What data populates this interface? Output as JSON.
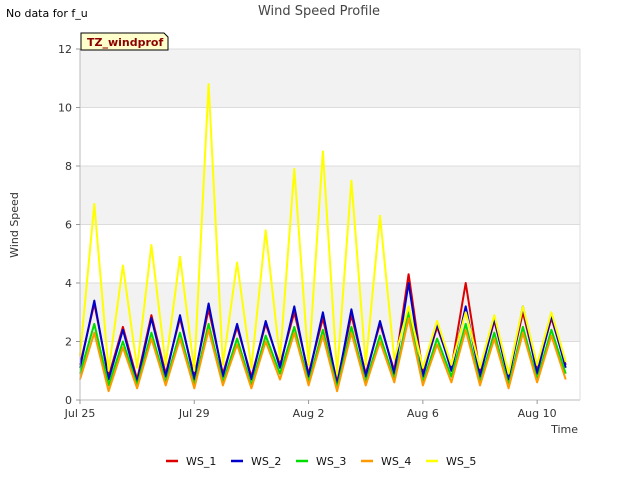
{
  "note": "No data for f_u",
  "chart_data": {
    "type": "line",
    "title": "Wind Speed Profile",
    "xlabel": "Time",
    "ylabel": "Wind Speed",
    "site_tag": "TZ_windprof",
    "ylim": [
      0,
      12
    ],
    "xlim": [
      "2023-07-25",
      "2023-08-11T12:00"
    ],
    "yticks": [
      0,
      2,
      4,
      6,
      8,
      10,
      12
    ],
    "xticks": [
      {
        "date": "2023-07-25",
        "label": "Jul 25"
      },
      {
        "date": "2023-07-29",
        "label": "Jul 29"
      },
      {
        "date": "2023-08-02",
        "label": "Aug 2"
      },
      {
        "date": "2023-08-06",
        "label": "Aug 6"
      },
      {
        "date": "2023-08-10",
        "label": "Aug 10"
      }
    ],
    "shaded_bands": [
      [
        2,
        4
      ],
      [
        6,
        8
      ],
      [
        10,
        12
      ]
    ],
    "legend_position": "bottom",
    "series": [
      {
        "name": "WS_1",
        "color": "#dd0000",
        "x": [
          "2023-07-25T00:00",
          "2023-07-25T12:00",
          "2023-07-26T00:00",
          "2023-07-26T12:00",
          "2023-07-27T00:00",
          "2023-07-27T12:00",
          "2023-07-28T00:00",
          "2023-07-28T12:00",
          "2023-07-29T00:00",
          "2023-07-29T12:00",
          "2023-07-30T00:00",
          "2023-07-30T12:00",
          "2023-07-31T00:00",
          "2023-07-31T12:00",
          "2023-08-01T00:00",
          "2023-08-01T12:00",
          "2023-08-02T00:00",
          "2023-08-02T12:00",
          "2023-08-03T00:00",
          "2023-08-03T12:00",
          "2023-08-04T00:00",
          "2023-08-04T12:00",
          "2023-08-05T00:00",
          "2023-08-05T12:00",
          "2023-08-06T00:00",
          "2023-08-06T12:00",
          "2023-08-07T00:00",
          "2023-08-07T12:00",
          "2023-08-08T00:00",
          "2023-08-08T12:00",
          "2023-08-09T00:00",
          "2023-08-09T12:00",
          "2023-08-10T00:00",
          "2023-08-10T12:00",
          "2023-08-11T00:00"
        ],
        "values": [
          1.2,
          3.3,
          0.8,
          2.5,
          0.7,
          2.9,
          0.9,
          2.8,
          0.8,
          3.1,
          0.9,
          2.5,
          0.8,
          2.6,
          1.2,
          3.0,
          0.9,
          2.8,
          0.6,
          2.9,
          0.9,
          2.6,
          1.0,
          4.3,
          0.9,
          2.5,
          1.1,
          4.0,
          0.9,
          2.7,
          0.8,
          3.0,
          1.0,
          2.8,
          1.2
        ]
      },
      {
        "name": "WS_2",
        "color": "#0000cc",
        "x": [
          "2023-07-25T00:00",
          "2023-07-25T12:00",
          "2023-07-26T00:00",
          "2023-07-26T12:00",
          "2023-07-27T00:00",
          "2023-07-27T12:00",
          "2023-07-28T00:00",
          "2023-07-28T12:00",
          "2023-07-29T00:00",
          "2023-07-29T12:00",
          "2023-07-30T00:00",
          "2023-07-30T12:00",
          "2023-07-31T00:00",
          "2023-07-31T12:00",
          "2023-08-01T00:00",
          "2023-08-01T12:00",
          "2023-08-02T00:00",
          "2023-08-02T12:00",
          "2023-08-03T00:00",
          "2023-08-03T12:00",
          "2023-08-04T00:00",
          "2023-08-04T12:00",
          "2023-08-05T00:00",
          "2023-08-05T12:00",
          "2023-08-06T00:00",
          "2023-08-06T12:00",
          "2023-08-07T00:00",
          "2023-08-07T12:00",
          "2023-08-08T00:00",
          "2023-08-08T12:00",
          "2023-08-09T00:00",
          "2023-08-09T12:00",
          "2023-08-10T00:00",
          "2023-08-10T12:00",
          "2023-08-11T00:00"
        ],
        "values": [
          1.1,
          3.4,
          0.7,
          2.4,
          0.6,
          2.8,
          0.8,
          2.9,
          0.7,
          3.3,
          0.8,
          2.6,
          0.7,
          2.7,
          1.1,
          3.2,
          0.8,
          3.0,
          0.5,
          3.1,
          0.8,
          2.7,
          0.9,
          4.0,
          0.8,
          2.6,
          1.0,
          3.2,
          0.8,
          2.8,
          0.7,
          3.2,
          0.9,
          2.9,
          1.1
        ]
      },
      {
        "name": "WS_3",
        "color": "#00dd00",
        "x": [
          "2023-07-25T00:00",
          "2023-07-25T12:00",
          "2023-07-26T00:00",
          "2023-07-26T12:00",
          "2023-07-27T00:00",
          "2023-07-27T12:00",
          "2023-07-28T00:00",
          "2023-07-28T12:00",
          "2023-07-29T00:00",
          "2023-07-29T12:00",
          "2023-07-30T00:00",
          "2023-07-30T12:00",
          "2023-07-31T00:00",
          "2023-07-31T12:00",
          "2023-08-01T00:00",
          "2023-08-01T12:00",
          "2023-08-02T00:00",
          "2023-08-02T12:00",
          "2023-08-03T00:00",
          "2023-08-03T12:00",
          "2023-08-04T00:00",
          "2023-08-04T12:00",
          "2023-08-05T00:00",
          "2023-08-05T12:00",
          "2023-08-06T00:00",
          "2023-08-06T12:00",
          "2023-08-07T00:00",
          "2023-08-07T12:00",
          "2023-08-08T00:00",
          "2023-08-08T12:00",
          "2023-08-09T00:00",
          "2023-08-09T12:00",
          "2023-08-10T00:00",
          "2023-08-10T12:00",
          "2023-08-11T00:00"
        ],
        "values": [
          0.9,
          2.6,
          0.5,
          2.0,
          0.5,
          2.3,
          0.6,
          2.3,
          0.5,
          2.6,
          0.6,
          2.1,
          0.5,
          2.2,
          0.9,
          2.5,
          0.6,
          2.4,
          0.4,
          2.5,
          0.6,
          2.2,
          0.7,
          3.0,
          0.6,
          2.1,
          0.8,
          2.6,
          0.6,
          2.3,
          0.5,
          2.5,
          0.7,
          2.4,
          0.9
        ]
      },
      {
        "name": "WS_4",
        "color": "#ff9900",
        "x": [
          "2023-07-25T00:00",
          "2023-07-25T12:00",
          "2023-07-26T00:00",
          "2023-07-26T12:00",
          "2023-07-27T00:00",
          "2023-07-27T12:00",
          "2023-07-28T00:00",
          "2023-07-28T12:00",
          "2023-07-29T00:00",
          "2023-07-29T12:00",
          "2023-07-30T00:00",
          "2023-07-30T12:00",
          "2023-07-31T00:00",
          "2023-07-31T12:00",
          "2023-08-01T00:00",
          "2023-08-01T12:00",
          "2023-08-02T00:00",
          "2023-08-02T12:00",
          "2023-08-03T00:00",
          "2023-08-03T12:00",
          "2023-08-04T00:00",
          "2023-08-04T12:00",
          "2023-08-05T00:00",
          "2023-08-05T12:00",
          "2023-08-06T00:00",
          "2023-08-06T12:00",
          "2023-08-07T00:00",
          "2023-08-07T12:00",
          "2023-08-08T00:00",
          "2023-08-08T12:00",
          "2023-08-09T00:00",
          "2023-08-09T12:00",
          "2023-08-10T00:00",
          "2023-08-10T12:00",
          "2023-08-11T00:00"
        ],
        "values": [
          0.7,
          2.3,
          0.3,
          1.8,
          0.4,
          2.1,
          0.5,
          2.1,
          0.4,
          2.4,
          0.5,
          1.9,
          0.4,
          2.0,
          0.7,
          2.3,
          0.5,
          2.2,
          0.3,
          2.3,
          0.5,
          2.0,
          0.6,
          2.8,
          0.5,
          1.9,
          0.6,
          2.4,
          0.5,
          2.1,
          0.4,
          2.3,
          0.6,
          2.2,
          0.7
        ]
      },
      {
        "name": "WS_5",
        "color": "#ffff00",
        "x": [
          "2023-07-25T00:00",
          "2023-07-25T12:00",
          "2023-07-26T00:00",
          "2023-07-26T12:00",
          "2023-07-27T00:00",
          "2023-07-27T12:00",
          "2023-07-28T00:00",
          "2023-07-28T12:00",
          "2023-07-29T00:00",
          "2023-07-29T12:00",
          "2023-07-30T00:00",
          "2023-07-30T12:00",
          "2023-07-31T00:00",
          "2023-07-31T12:00",
          "2023-08-01T00:00",
          "2023-08-01T12:00",
          "2023-08-02T00:00",
          "2023-08-02T12:00",
          "2023-08-03T00:00",
          "2023-08-03T12:00",
          "2023-08-04T00:00",
          "2023-08-04T12:00",
          "2023-08-05T00:00",
          "2023-08-05T12:00",
          "2023-08-06T00:00",
          "2023-08-06T12:00",
          "2023-08-07T00:00",
          "2023-08-07T12:00",
          "2023-08-08T00:00",
          "2023-08-08T12:00",
          "2023-08-09T00:00",
          "2023-08-09T12:00",
          "2023-08-10T00:00",
          "2023-08-10T12:00",
          "2023-08-11T00:00"
        ],
        "values": [
          1.5,
          6.7,
          1.0,
          4.6,
          1.1,
          5.3,
          1.2,
          4.9,
          1.0,
          10.8,
          1.2,
          4.7,
          1.1,
          5.8,
          1.4,
          7.9,
          1.2,
          8.5,
          0.9,
          7.5,
          1.2,
          6.3,
          1.4,
          3.2,
          1.1,
          2.7,
          1.2,
          3.0,
          1.1,
          2.9,
          0.9,
          3.2,
          1.2,
          3.0,
          1.3
        ]
      }
    ]
  }
}
